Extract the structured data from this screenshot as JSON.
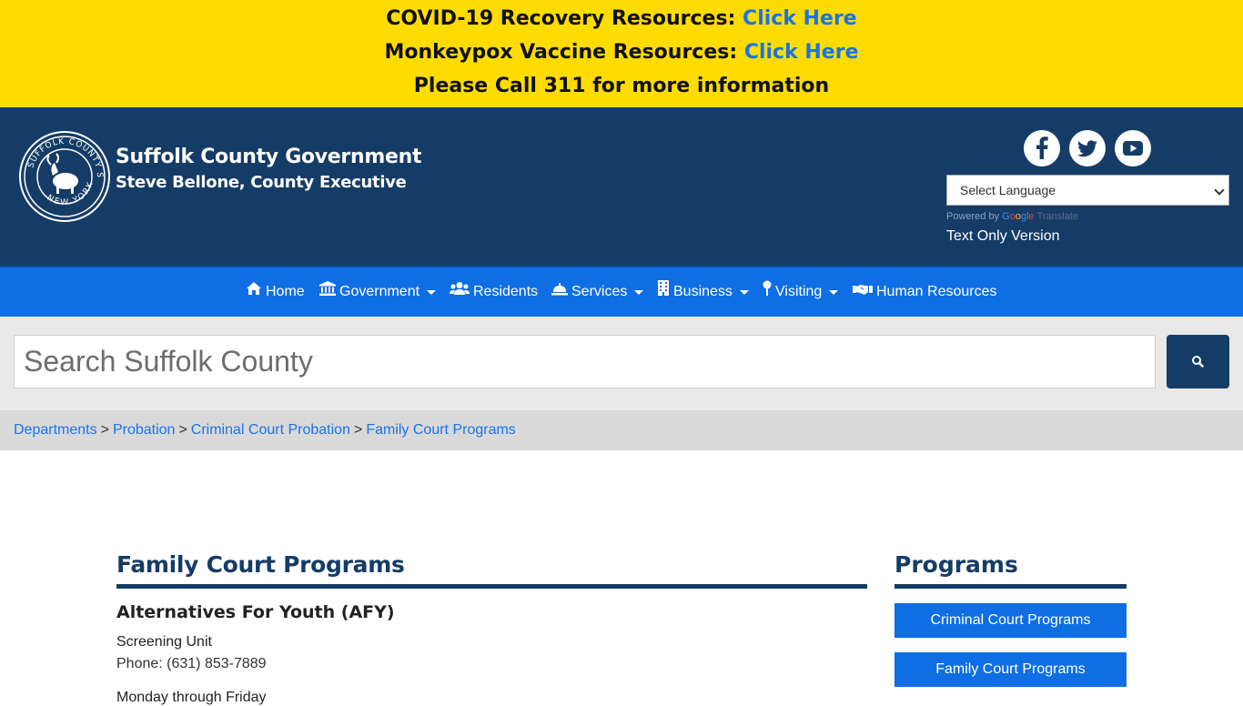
{
  "alerts": {
    "covid_text": "COVID-19 Recovery Resources:",
    "covid_link": "Click Here",
    "monkeypox_text": "Monkeypox Vaccine Resources:",
    "monkeypox_link": "Click Here",
    "call_text": "Please Call 311 for more information"
  },
  "header": {
    "title": "Suffolk County Government",
    "subtitle": "Steve Bellone, County Executive",
    "seal_text": "SUFFOLK COUNTY SEAL NEW YORK",
    "language_select": "Select Language",
    "powered_by": "Powered by",
    "google": "Google",
    "translate": "Translate",
    "text_only": "Text Only Version",
    "social_icons": [
      "facebook-icon",
      "twitter-icon",
      "youtube-icon"
    ]
  },
  "nav": {
    "items": [
      {
        "label": "Home",
        "icon": "home-icon",
        "dropdown": false
      },
      {
        "label": "Government",
        "icon": "government-icon",
        "dropdown": true
      },
      {
        "label": "Residents",
        "icon": "users-icon",
        "dropdown": false
      },
      {
        "label": "Services",
        "icon": "bell-icon",
        "dropdown": true
      },
      {
        "label": "Business",
        "icon": "building-icon",
        "dropdown": true
      },
      {
        "label": "Visiting",
        "icon": "map-pin-icon",
        "dropdown": true
      },
      {
        "label": "Human Resources",
        "icon": "handshake-icon",
        "dropdown": false
      }
    ]
  },
  "search": {
    "placeholder": "Search Suffolk County",
    "icon": "search-icon"
  },
  "breadcrumb": {
    "items": [
      "Departments",
      "Probation",
      "Criminal Court Probation",
      "Family Court Programs"
    ],
    "separator": ">"
  },
  "main": {
    "title": "Family Court Programs",
    "section_title": "Alternatives For Youth (AFY)",
    "unit_name": "Screening Unit",
    "unit_phone": "Phone: (631) 853-7889",
    "unit_hours": "Monday through Friday"
  },
  "sidebar": {
    "title": "Programs",
    "buttons": [
      "Criminal Court Programs",
      "Family Court Programs"
    ]
  },
  "colors": {
    "alert_bg": "#fedc00",
    "header_bg": "#153c66",
    "nav_bg": "#0f6ee3",
    "link": "#1a73e8"
  }
}
